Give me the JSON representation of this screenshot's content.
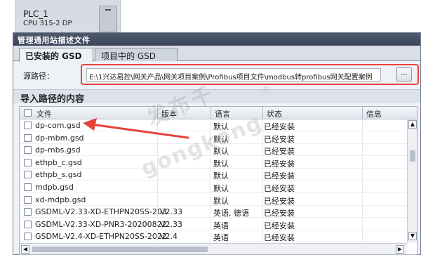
{
  "plc": {
    "name": "PLC_1",
    "cpu": "CPU 315-2 DP"
  },
  "dialog": {
    "title": "管理通用站描述文件",
    "tabs": [
      {
        "label": "已安装的 GSD",
        "active": true
      },
      {
        "label": "项目中的 GSD",
        "active": false
      }
    ],
    "source_path_label": "源路径：",
    "source_path_value": "E:\\1兴达易控\\网关产品\\网关项目案例\\Profibus项目文件\\modbus转profibus网关配置案例",
    "browse_label": "...",
    "content_title": "导入路径的内容",
    "table": {
      "columns": [
        "文件",
        "版本",
        "语言",
        "状态",
        "信息"
      ],
      "rows": [
        {
          "file": "dp-com.gsd",
          "version": "",
          "language": "默认",
          "status": "已经安装"
        },
        {
          "file": "dp-mbm.gsd",
          "version": "",
          "language": "默认",
          "status": "已经安装"
        },
        {
          "file": "dp-mbs.gsd",
          "version": "",
          "language": "默认",
          "status": "已经安装"
        },
        {
          "file": "ethpb_c.gsd",
          "version": "",
          "language": "默认",
          "status": "已经安装"
        },
        {
          "file": "ethpb_s.gsd",
          "version": "",
          "language": "默认",
          "status": "已经安装"
        },
        {
          "file": "mdpb.gsd",
          "version": "",
          "language": "默认",
          "status": "已经安装"
        },
        {
          "file": "xd-mdpb.gsd",
          "version": "",
          "language": "默认",
          "status": "已经安装"
        },
        {
          "file": "GSDML-V2.33-XD-ETHPN20SS-203...",
          "version": "V2.33",
          "language": "英语, 德语",
          "status": "已经安装"
        },
        {
          "file": "GSDML-V2.33-XD-PNR3-20200822...",
          "version": "V2.33",
          "language": "英语",
          "status": "已经安装"
        },
        {
          "file": "GSDML-V2.4-XD-ETHPN20SS-2022...",
          "version": "V2.4",
          "language": "英语",
          "status": "已经安装"
        }
      ]
    }
  },
  "watermark": {
    "logo": "发布千",
    "pinyin": "gongkong",
    "reg": "®"
  },
  "colors": {
    "highlight": "#e8433a",
    "titlebar": "#4f5a6e"
  },
  "icons": {
    "arrow": "red-pointer-arrow-icon",
    "checkbox": "checkbox-icon"
  }
}
